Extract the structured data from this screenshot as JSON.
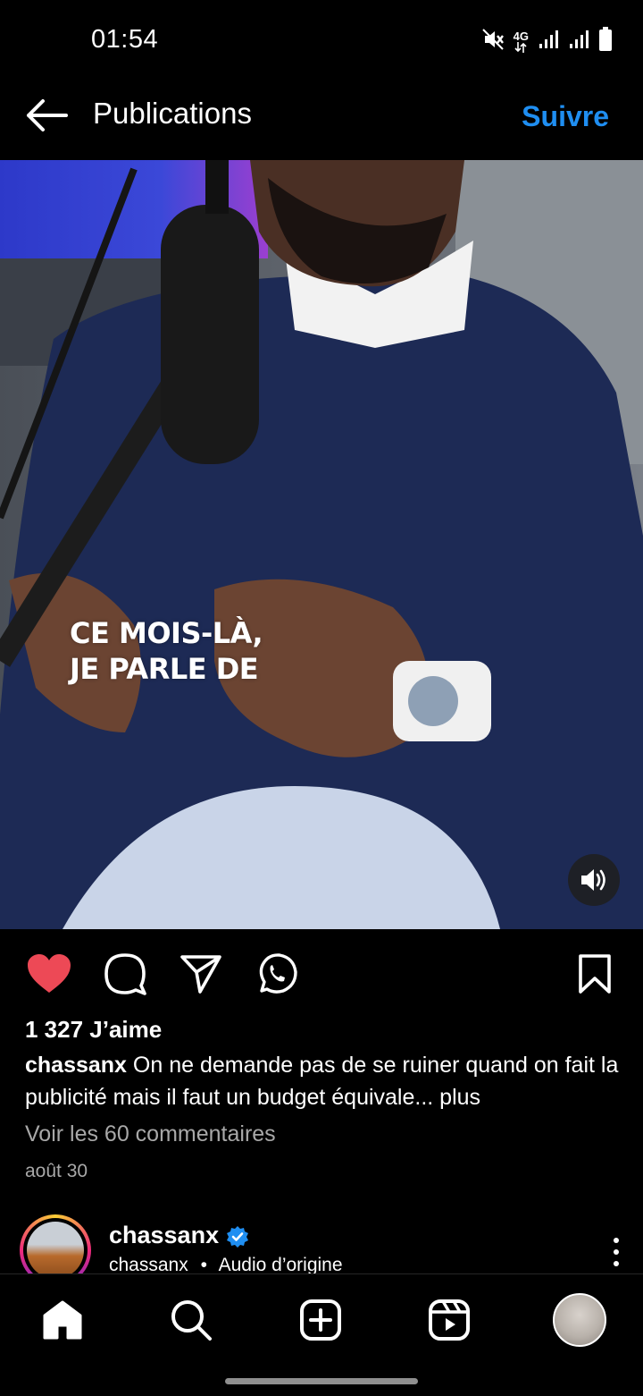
{
  "status_bar": {
    "time": "01:54",
    "network": "4G",
    "icons": [
      "mute-icon",
      "4g-icon",
      "signal-icon",
      "signal-icon",
      "battery-icon"
    ]
  },
  "header": {
    "back_icon": "arrow-left-icon",
    "title": "Publications",
    "follow_label": "Suivre"
  },
  "video": {
    "caption_lines": [
      "CE MOIS-LÀ,",
      "JE PARLE DE"
    ],
    "sound_icon": "speaker-icon"
  },
  "actions": {
    "icons": [
      "heart-filled-icon",
      "comment-icon",
      "share-icon",
      "whatsapp-icon",
      "bookmark-icon"
    ],
    "liked": true,
    "like_color": "#ed4956"
  },
  "post": {
    "likes": "1 327 J’aime",
    "caption_user": "chassanx",
    "caption_text": " On ne demande pas de se ruiner quand on fait la publicité mais il faut un budget équivale...",
    "caption_more": " plus",
    "comments_link": "Voir les 60 commentaires",
    "date": "août 30"
  },
  "next_post": {
    "author": "chassanx",
    "verified": true,
    "audio_user": "chassanx",
    "separator": "•",
    "audio_label": "Audio d’origine"
  },
  "bottom_nav": {
    "items": [
      "home-icon",
      "search-icon",
      "create-icon",
      "reels-icon",
      "profile-avatar"
    ]
  },
  "colors": {
    "accent": "#1f8ef1",
    "background": "#000000",
    "muted_text": "#a8a8a8"
  }
}
